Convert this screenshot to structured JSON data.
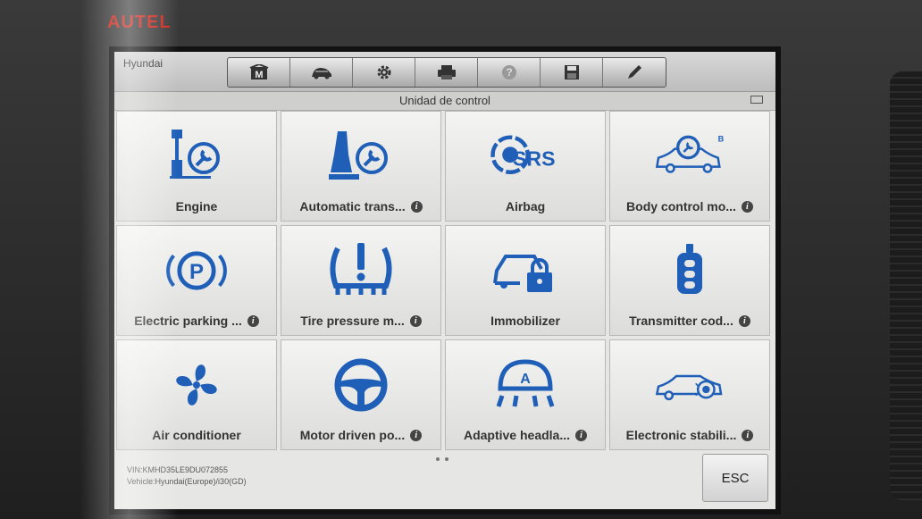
{
  "device": {
    "brand": "AUTEL"
  },
  "header": {
    "vehicle_name": "Hyundai",
    "toolbar": [
      {
        "name": "home-icon"
      },
      {
        "name": "vehicle-swap-icon"
      },
      {
        "name": "settings-icon"
      },
      {
        "name": "print-icon"
      },
      {
        "name": "help-icon"
      },
      {
        "name": "save-icon"
      },
      {
        "name": "edit-icon"
      }
    ]
  },
  "title_bar": {
    "title": "Unidad de control"
  },
  "tiles": [
    {
      "label": "Engine",
      "icon": "engine-icon",
      "info": false
    },
    {
      "label": "Automatic trans...",
      "icon": "automatic-transmission-icon",
      "info": true
    },
    {
      "label": "Airbag",
      "icon": "srs-airbag-icon",
      "info": false
    },
    {
      "label": "Body control mo...",
      "icon": "body-control-icon",
      "info": true
    },
    {
      "label": "Electric parking ...",
      "icon": "parking-brake-icon",
      "info": true
    },
    {
      "label": "Tire pressure m...",
      "icon": "tire-pressure-icon",
      "info": true
    },
    {
      "label": "Immobilizer",
      "icon": "immobilizer-icon",
      "info": false
    },
    {
      "label": "Transmitter cod...",
      "icon": "key-fob-icon",
      "info": true
    },
    {
      "label": "Air conditioner",
      "icon": "fan-icon",
      "info": false
    },
    {
      "label": "Motor driven po...",
      "icon": "steering-wheel-icon",
      "info": true
    },
    {
      "label": "Adaptive headla...",
      "icon": "adaptive-headlight-icon",
      "info": true
    },
    {
      "label": "Electronic stabili...",
      "icon": "stability-control-icon",
      "info": true
    }
  ],
  "footer": {
    "vin_line": "VIN:KMHD35LE9DU072855",
    "vehicle_line": "Vehicle:Hyundai(Europe)/i30(GD)",
    "esc_label": "ESC"
  },
  "colors": {
    "icon_blue": "#1f5fb8",
    "brand_red": "#c8261c"
  }
}
